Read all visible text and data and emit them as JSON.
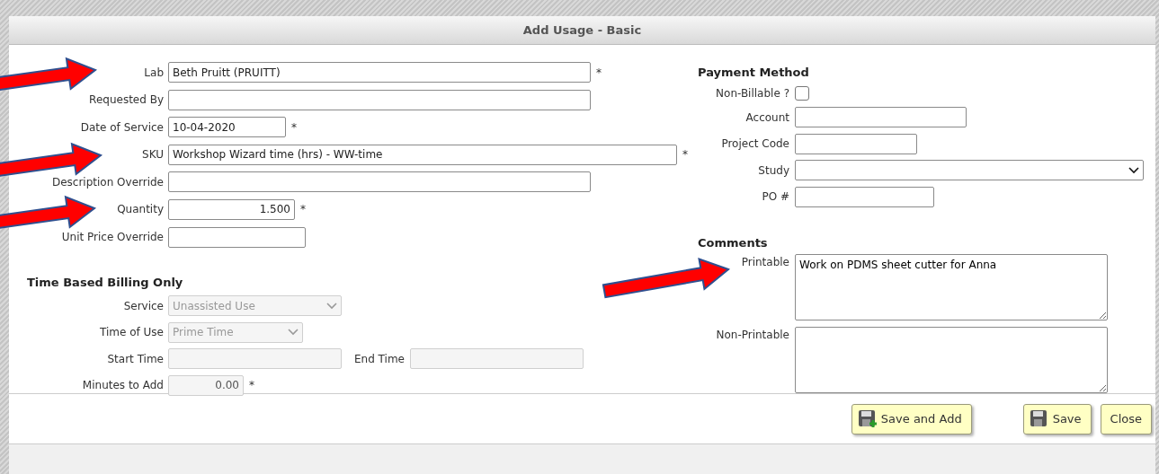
{
  "dialog": {
    "title": "Add Usage - Basic"
  },
  "details": {
    "fields": [
      {
        "label": "Lab",
        "kind": "text",
        "value": "Beth Pruitt (PRUITT)",
        "suffix": "*"
      },
      {
        "label": "Requested By",
        "kind": "text"
      },
      {
        "label": "Date of Service",
        "kind": "text",
        "value": "10-04-2020",
        "suffix": "*"
      },
      {
        "label": "SKU",
        "kind": "text",
        "value": "Workshop Wizard time (hrs) - WW-time",
        "suffix": "*"
      },
      {
        "label": "Description Override",
        "kind": "text"
      },
      {
        "label": "Quantity",
        "kind": "number",
        "value": "1.500",
        "suffix": "*"
      },
      {
        "label": "Unit Price Override",
        "kind": "text"
      }
    ]
  },
  "time_billing": {
    "heading": "Time Based Billing Only",
    "fields": [
      {
        "label": "Service",
        "kind": "select",
        "value": "Unassisted Use",
        "disabled": true
      },
      {
        "label": "Time of Use",
        "kind": "select",
        "value": "Prime Time",
        "disabled": true
      },
      {
        "label": "Start Time",
        "kind": "text",
        "disabled": true,
        "pair": {
          "label": "End Time",
          "kind": "text",
          "disabled": true
        }
      },
      {
        "label": "Minutes to Add",
        "kind": "number",
        "value": "0.00",
        "disabled": true,
        "suffix": "*"
      }
    ]
  },
  "payment": {
    "heading": "Payment Method",
    "fields": [
      {
        "label": "Non-Billable ?",
        "kind": "checkbox",
        "checked": false
      },
      {
        "label": "Account",
        "kind": "text"
      },
      {
        "label": "Project Code",
        "kind": "text"
      },
      {
        "label": "Study",
        "kind": "select",
        "disabled": false
      },
      {
        "label": "PO #",
        "kind": "text"
      }
    ]
  },
  "comments": {
    "heading": "Comments",
    "fields": [
      {
        "label": "Printable",
        "kind": "textarea",
        "value": "Work on PDMS sheet cutter for Anna"
      },
      {
        "label": "Non-Printable",
        "kind": "textarea"
      }
    ]
  },
  "buttons": [
    {
      "label": "Save and Add",
      "kind": "save-add"
    },
    {
      "label": "Save",
      "kind": "save"
    },
    {
      "label": "Close",
      "kind": "plain"
    }
  ]
}
